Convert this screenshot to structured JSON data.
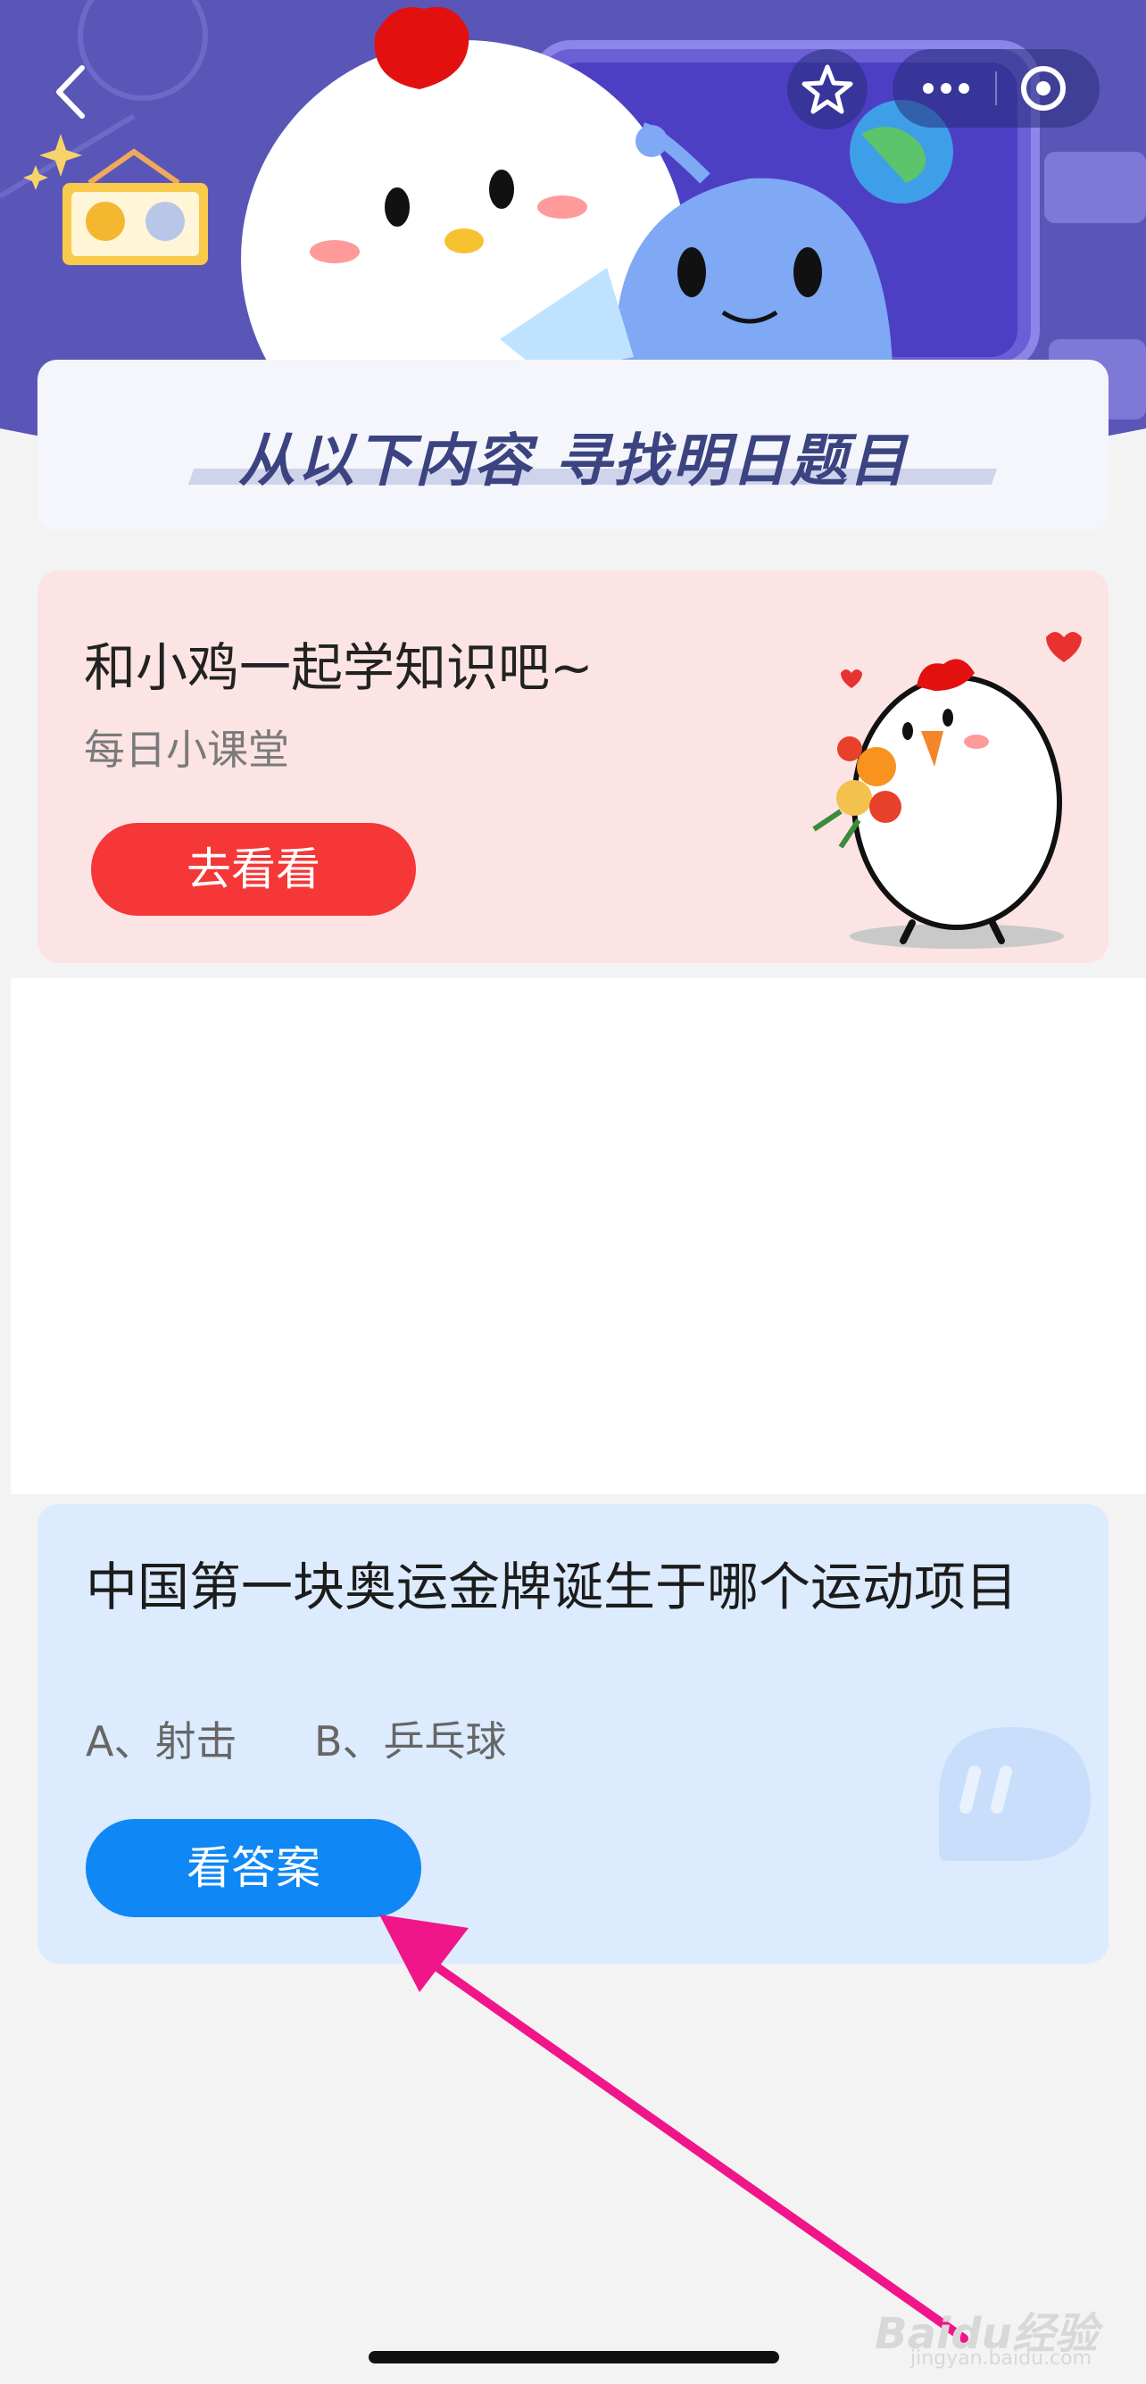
{
  "header": {
    "banner_text": "从以下内容  寻找明日题目"
  },
  "nav": {
    "back_icon": "chevron-left-icon",
    "star_icon": "star-outline-icon",
    "more_icon": "more-horizontal-icon",
    "close_icon": "target-circle-icon"
  },
  "chicken_card": {
    "title": "和小鸡一起学知识吧~",
    "subtitle": "每日小课堂",
    "button_label": "去看看",
    "button_color": "#f53737",
    "background": "#fde4e4"
  },
  "question_card": {
    "question": "中国第一块奥运金牌诞生于哪个运动项目",
    "option_a": "A、射击",
    "option_b": "B、乒乓球",
    "button_label": "看答案",
    "button_color": "#0f87f5",
    "background": "#dcebfd"
  },
  "watermark": {
    "text": "Baidu经验",
    "sub": "jingyan.baidu.com"
  },
  "colors": {
    "header_purple": "#5a56b8",
    "annotation_arrow": "#f0168a"
  }
}
